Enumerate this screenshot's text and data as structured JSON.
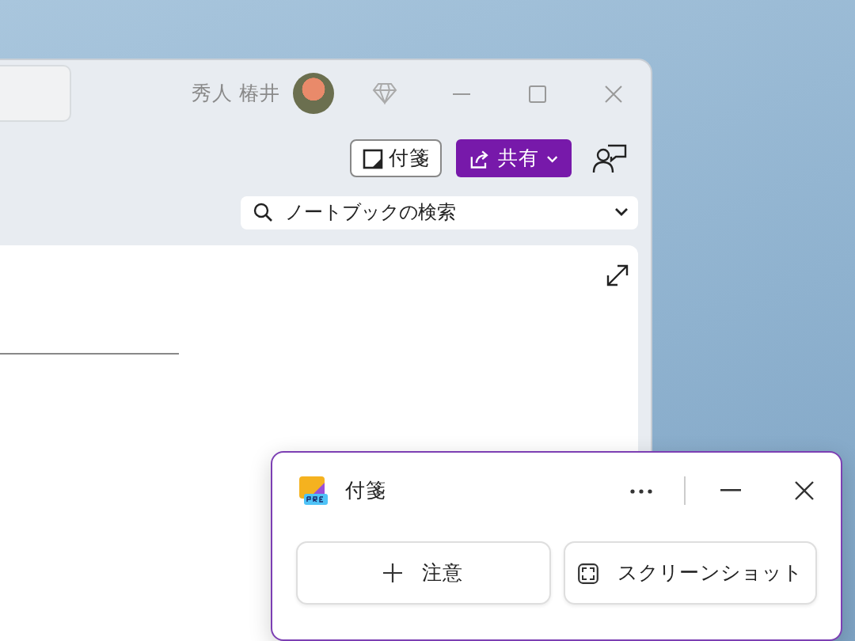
{
  "notebook_window": {
    "user_name": "秀人 椿井",
    "buttons": [
      {
        "label": "付箋",
        "kind": "outline"
      },
      {
        "label": "共有",
        "kind": "primary"
      }
    ],
    "search": {
      "placeholder": "ノートブックの検索"
    }
  },
  "sticky_notes_window": {
    "title": "付箋",
    "buttons": [
      {
        "label": "注意",
        "kind": "add"
      },
      {
        "label": "スクリーンショット",
        "kind": "screenshot"
      }
    ]
  }
}
